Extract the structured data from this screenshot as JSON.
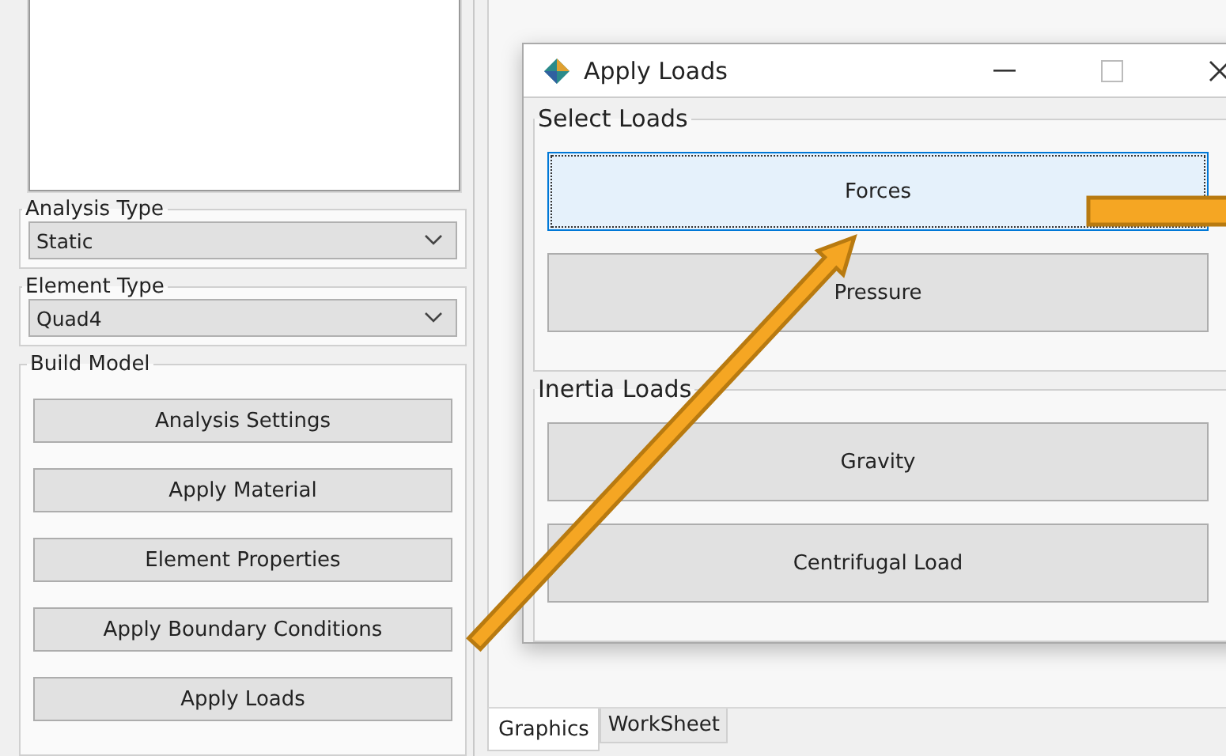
{
  "left_panel": {
    "analysis_type": {
      "label": "Analysis Type",
      "value": "Static"
    },
    "element_type": {
      "label": "Element Type",
      "value": "Quad4"
    },
    "build_model": {
      "label": "Build Model",
      "buttons": [
        "Analysis Settings",
        "Apply Material",
        "Element Properties",
        "Apply Boundary Conditions",
        "Apply Loads"
      ]
    }
  },
  "dialog": {
    "title": "Apply Loads",
    "groups": [
      {
        "label": "Select Loads",
        "buttons": [
          {
            "label": "Forces",
            "selected": true
          },
          {
            "label": "Pressure",
            "selected": false
          }
        ]
      },
      {
        "label": "Inertia Loads",
        "buttons": [
          {
            "label": "Gravity",
            "selected": false
          },
          {
            "label": "Centrifugal Load",
            "selected": false
          }
        ]
      }
    ]
  },
  "tabs": [
    {
      "label": "Graphics",
      "selected": true
    },
    {
      "label": "WorkSheet",
      "selected": false
    }
  ]
}
